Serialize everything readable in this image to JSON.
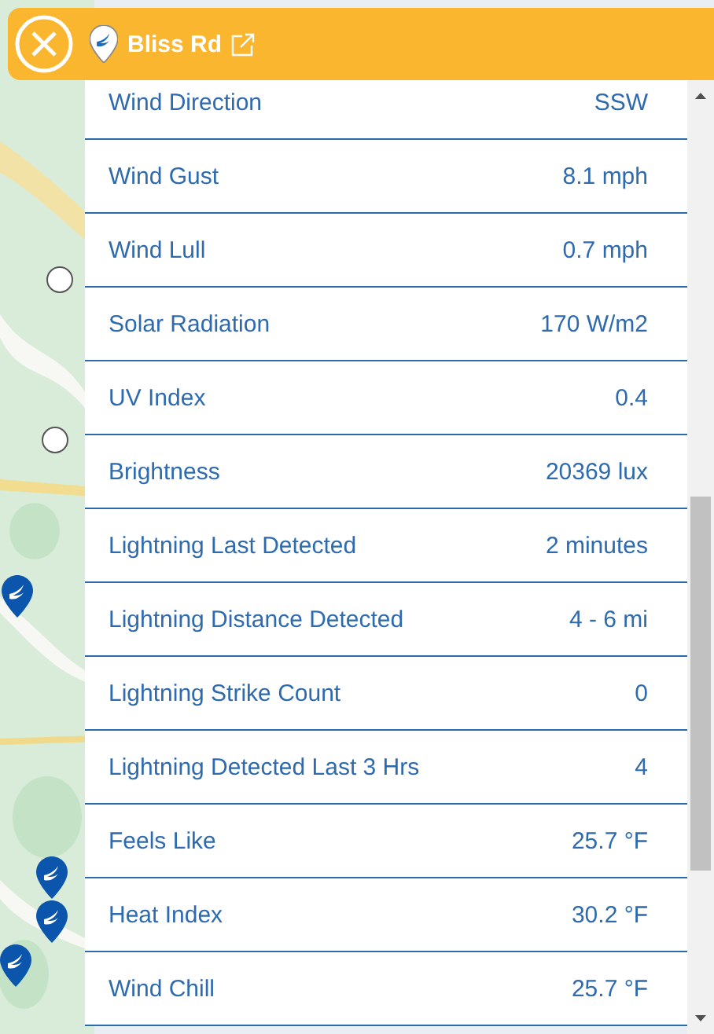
{
  "header": {
    "title": "Bliss Rd"
  },
  "readings": [
    {
      "label": "Wind Direction",
      "value": "SSW"
    },
    {
      "label": "Wind Gust",
      "value": "8.1 mph"
    },
    {
      "label": "Wind Lull",
      "value": "0.7 mph"
    },
    {
      "label": "Solar Radiation",
      "value": "170 W/m2"
    },
    {
      "label": "UV Index",
      "value": "0.4"
    },
    {
      "label": "Brightness",
      "value": "20369 lux"
    },
    {
      "label": "Lightning Last Detected",
      "value": "2 minutes"
    },
    {
      "label": "Lightning Distance Detected",
      "value": "4 - 6 mi"
    },
    {
      "label": "Lightning Strike Count",
      "value": "0"
    },
    {
      "label": "Lightning Detected Last 3 Hrs",
      "value": "4"
    },
    {
      "label": "Feels Like",
      "value": "25.7 °F"
    },
    {
      "label": "Heat Index",
      "value": "30.2 °F"
    },
    {
      "label": "Wind Chill",
      "value": "25.7 °F"
    }
  ]
}
